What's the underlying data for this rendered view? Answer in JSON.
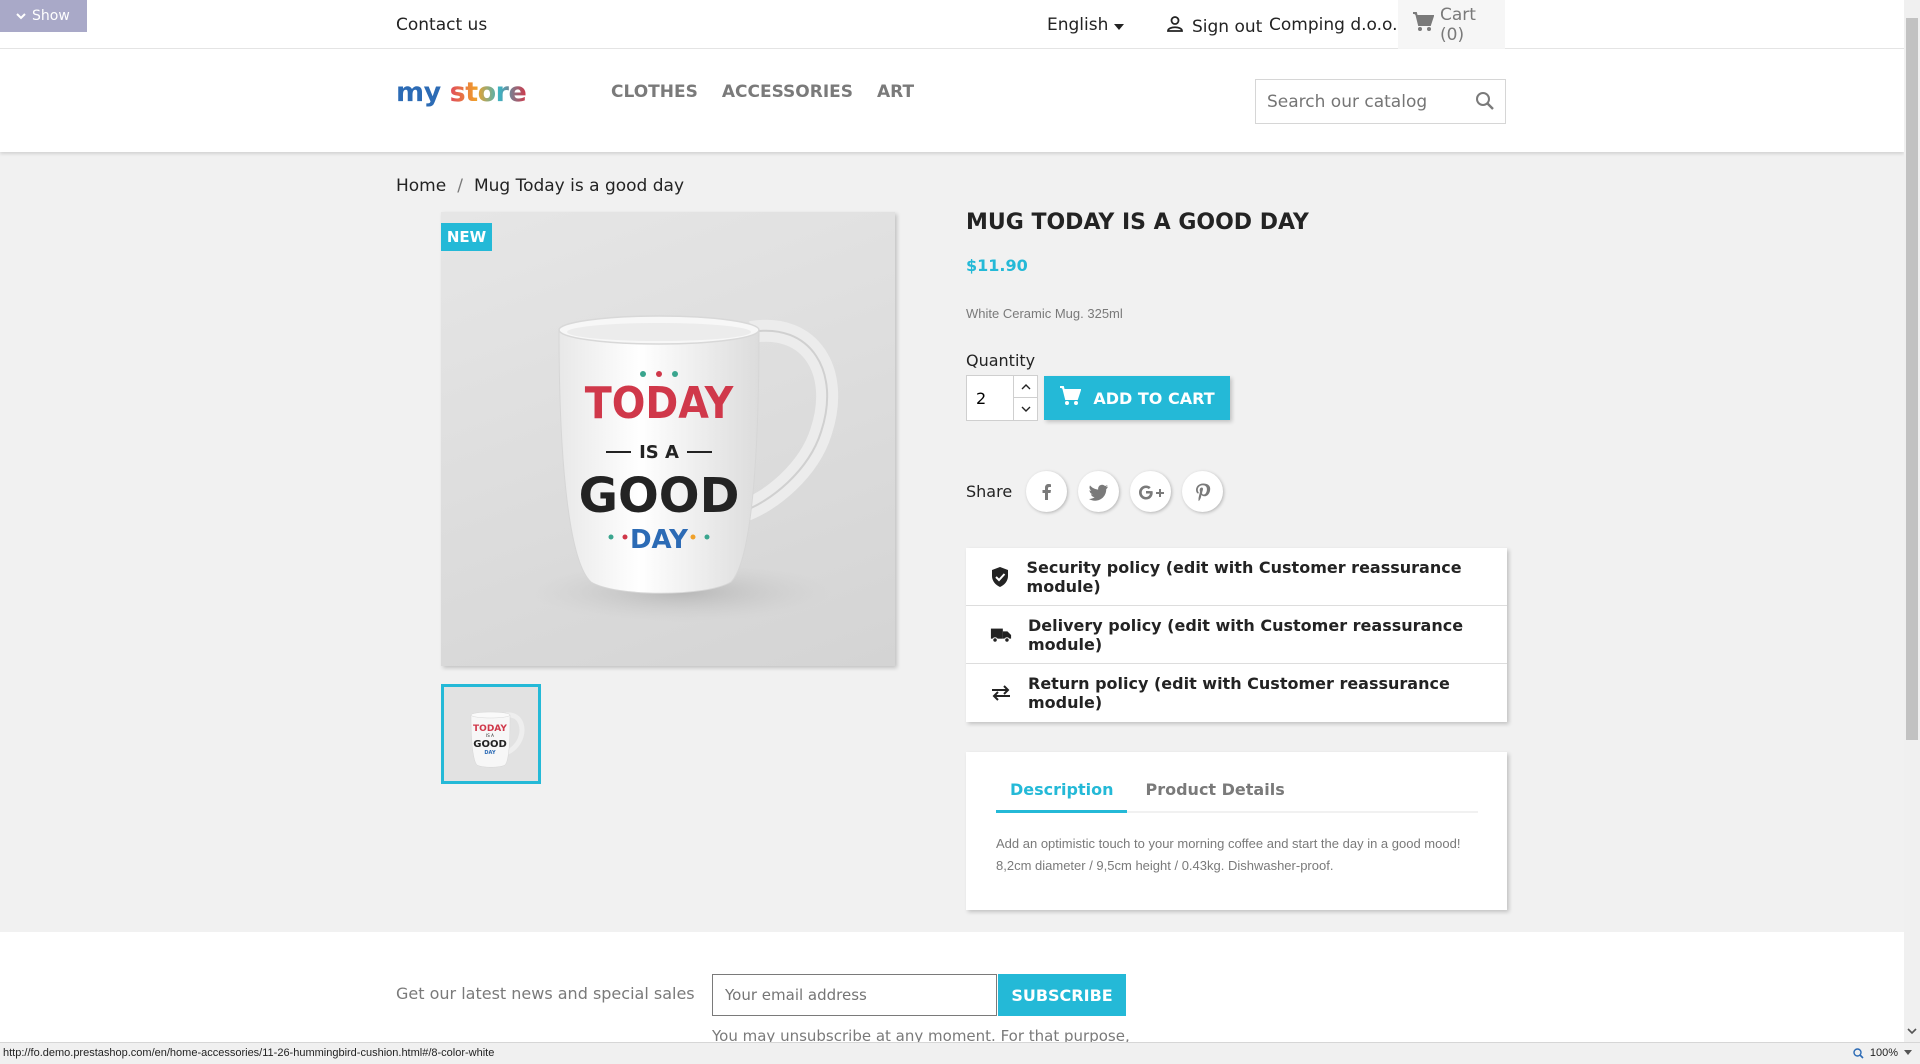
{
  "debug_toggle": {
    "label": "Show",
    "icon": "chevron-down-icon"
  },
  "topnav": {
    "contact": "Contact us",
    "language": "English",
    "sign_out": "Sign out",
    "customer": "Comping d.o.o.",
    "cart": "Cart (0)"
  },
  "header": {
    "logo": {
      "word1": "my",
      "word2": "store"
    },
    "menu": [
      "CLOTHES",
      "ACCESSORIES",
      "ART"
    ],
    "search_placeholder": "Search our catalog"
  },
  "breadcrumb": [
    "Home",
    "Mug Today is a good day"
  ],
  "breadcrumb_sep": "/",
  "product": {
    "flag": "NEW",
    "title": "MUG TODAY IS A GOOD DAY",
    "price": "$11.90",
    "short_description": "White Ceramic Mug. 325ml",
    "quantity_label": "Quantity",
    "quantity": "2",
    "add_to_cart": "ADD TO CART",
    "image_text": [
      "TODAY",
      "IS A",
      "GOOD",
      "DAY"
    ]
  },
  "share": {
    "label": "Share",
    "networks": [
      "facebook",
      "twitter",
      "google-plus",
      "pinterest"
    ]
  },
  "reassurance": [
    {
      "icon": "shield-check-icon",
      "text": "Security policy (edit with Customer reassurance module)"
    },
    {
      "icon": "truck-icon",
      "text": "Delivery policy (edit with Customer reassurance module)"
    },
    {
      "icon": "swap-arrows-icon",
      "text": "Return policy (edit with Customer reassurance module)"
    }
  ],
  "tabs": {
    "items": [
      "Description",
      "Product Details"
    ],
    "active": "Description",
    "description": "Add an optimistic touch to your morning coffee and start the day in a good mood! 8,2cm diameter / 9,5cm height / 0.43kg. Dishwasher-proof."
  },
  "footer": {
    "newsletter_label": "Get our latest news and special sales",
    "email_placeholder": "Your email address",
    "subscribe": "SUBSCRIBE",
    "note": "You may unsubscribe at any moment. For that purpose,"
  },
  "statusbar": {
    "url": "http://fo.demo.prestashop.com/en/home-accessories/11-26-hummingbird-cushion.html#/8-color-white",
    "zoom": "100%"
  },
  "colors": {
    "accent": "#24b9d7",
    "text": "#232323",
    "muted": "#7a7a7a",
    "background": "#f1f1f1"
  }
}
